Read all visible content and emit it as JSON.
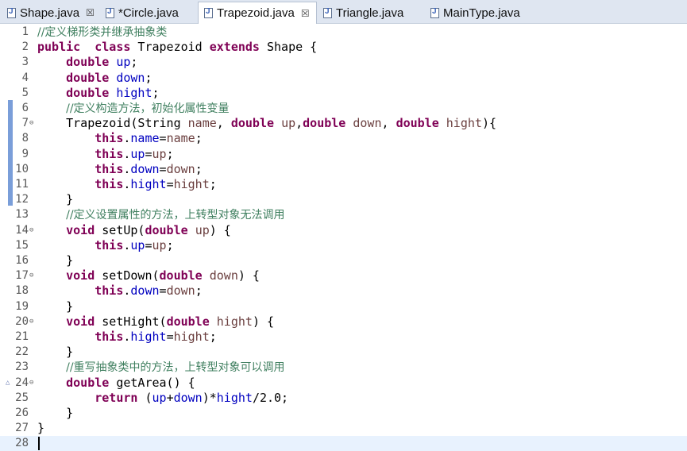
{
  "tabs": [
    {
      "label": "Shape.java",
      "closable": true
    },
    {
      "label": "*Circle.java",
      "closable": false
    },
    {
      "label": "Trapezoid.java",
      "closable": true,
      "active": true
    },
    {
      "label": "Triangle.java",
      "closable": false
    },
    {
      "label": "MainType.java",
      "closable": false
    }
  ],
  "close_glyph": "☒",
  "editor": {
    "lines": [
      {
        "n": "1",
        "t": [
          [
            "cm",
            "//定义梯形类并继承抽象类"
          ]
        ]
      },
      {
        "n": "2",
        "t": [
          [
            "kw",
            "public"
          ],
          [
            "",
            "  "
          ],
          [
            "kw",
            "class"
          ],
          [
            "",
            " Trapezoid "
          ],
          [
            "kw",
            "extends"
          ],
          [
            "",
            " Shape {"
          ]
        ]
      },
      {
        "n": "3",
        "t": [
          [
            "",
            "    "
          ],
          [
            "kw",
            "double"
          ],
          [
            "",
            " "
          ],
          [
            "fld",
            "up"
          ],
          [
            "",
            ";"
          ]
        ]
      },
      {
        "n": "4",
        "t": [
          [
            "",
            "    "
          ],
          [
            "kw",
            "double"
          ],
          [
            "",
            " "
          ],
          [
            "fld",
            "down"
          ],
          [
            "",
            ";"
          ]
        ]
      },
      {
        "n": "5",
        "t": [
          [
            "",
            "    "
          ],
          [
            "kw",
            "double"
          ],
          [
            "",
            " "
          ],
          [
            "fld",
            "hight"
          ],
          [
            "",
            ";"
          ]
        ]
      },
      {
        "n": "6",
        "t": [
          [
            "",
            "    "
          ],
          [
            "cm",
            "//定义构造方法，初始化属性变量"
          ]
        ]
      },
      {
        "n": "7",
        "fold": true,
        "t": [
          [
            "",
            "    Trapezoid(String "
          ],
          [
            "par",
            "name"
          ],
          [
            "",
            ", "
          ],
          [
            "kw",
            "double"
          ],
          [
            "",
            " "
          ],
          [
            "par",
            "up"
          ],
          [
            "",
            ","
          ],
          [
            "kw",
            "double"
          ],
          [
            "",
            " "
          ],
          [
            "par",
            "down"
          ],
          [
            "",
            ", "
          ],
          [
            "kw",
            "double"
          ],
          [
            "",
            " "
          ],
          [
            "par",
            "hight"
          ],
          [
            "",
            "){"
          ]
        ]
      },
      {
        "n": "8",
        "t": [
          [
            "",
            "        "
          ],
          [
            "kw",
            "this"
          ],
          [
            "",
            "."
          ],
          [
            "fld",
            "name"
          ],
          [
            "",
            "="
          ],
          [
            "par",
            "name"
          ],
          [
            "",
            ";"
          ]
        ]
      },
      {
        "n": "9",
        "t": [
          [
            "",
            "        "
          ],
          [
            "kw",
            "this"
          ],
          [
            "",
            "."
          ],
          [
            "fld",
            "up"
          ],
          [
            "",
            "="
          ],
          [
            "par",
            "up"
          ],
          [
            "",
            ";"
          ]
        ]
      },
      {
        "n": "10",
        "t": [
          [
            "",
            "        "
          ],
          [
            "kw",
            "this"
          ],
          [
            "",
            "."
          ],
          [
            "fld",
            "down"
          ],
          [
            "",
            "="
          ],
          [
            "par",
            "down"
          ],
          [
            "",
            ";"
          ]
        ]
      },
      {
        "n": "11",
        "t": [
          [
            "",
            "        "
          ],
          [
            "kw",
            "this"
          ],
          [
            "",
            "."
          ],
          [
            "fld",
            "hight"
          ],
          [
            "",
            "="
          ],
          [
            "par",
            "hight"
          ],
          [
            "",
            ";"
          ]
        ]
      },
      {
        "n": "12",
        "t": [
          [
            "",
            "    }"
          ]
        ]
      },
      {
        "n": "13",
        "t": [
          [
            "",
            "    "
          ],
          [
            "cm",
            "//定义设置属性的方法，上转型对象无法调用"
          ]
        ]
      },
      {
        "n": "14",
        "fold": true,
        "t": [
          [
            "",
            "    "
          ],
          [
            "kw",
            "void"
          ],
          [
            "",
            " setUp("
          ],
          [
            "kw",
            "double"
          ],
          [
            "",
            " "
          ],
          [
            "par",
            "up"
          ],
          [
            "",
            ") {"
          ]
        ]
      },
      {
        "n": "15",
        "t": [
          [
            "",
            "        "
          ],
          [
            "kw",
            "this"
          ],
          [
            "",
            "."
          ],
          [
            "fld",
            "up"
          ],
          [
            "",
            "="
          ],
          [
            "par",
            "up"
          ],
          [
            "",
            ";"
          ]
        ]
      },
      {
        "n": "16",
        "t": [
          [
            "",
            "    }"
          ]
        ]
      },
      {
        "n": "17",
        "fold": true,
        "t": [
          [
            "",
            "    "
          ],
          [
            "kw",
            "void"
          ],
          [
            "",
            " setDown("
          ],
          [
            "kw",
            "double"
          ],
          [
            "",
            " "
          ],
          [
            "par",
            "down"
          ],
          [
            "",
            ") {"
          ]
        ]
      },
      {
        "n": "18",
        "t": [
          [
            "",
            "        "
          ],
          [
            "kw",
            "this"
          ],
          [
            "",
            "."
          ],
          [
            "fld",
            "down"
          ],
          [
            "",
            "="
          ],
          [
            "par",
            "down"
          ],
          [
            "",
            ";"
          ]
        ]
      },
      {
        "n": "19",
        "t": [
          [
            "",
            "    }"
          ]
        ]
      },
      {
        "n": "20",
        "fold": true,
        "t": [
          [
            "",
            "    "
          ],
          [
            "kw",
            "void"
          ],
          [
            "",
            " setHight("
          ],
          [
            "kw",
            "double"
          ],
          [
            "",
            " "
          ],
          [
            "par",
            "hight"
          ],
          [
            "",
            ") {"
          ]
        ]
      },
      {
        "n": "21",
        "t": [
          [
            "",
            "        "
          ],
          [
            "kw",
            "this"
          ],
          [
            "",
            "."
          ],
          [
            "fld",
            "hight"
          ],
          [
            "",
            "="
          ],
          [
            "par",
            "hight"
          ],
          [
            "",
            ";"
          ]
        ]
      },
      {
        "n": "22",
        "t": [
          [
            "",
            "    }"
          ]
        ]
      },
      {
        "n": "23",
        "t": [
          [
            "",
            "    "
          ],
          [
            "cm",
            "//重写抽象类中的方法，上转型对象可以调用"
          ]
        ]
      },
      {
        "n": "24",
        "fold": true,
        "override": true,
        "t": [
          [
            "",
            "    "
          ],
          [
            "kw",
            "double"
          ],
          [
            "",
            " getArea() {"
          ]
        ]
      },
      {
        "n": "25",
        "t": [
          [
            "",
            "        "
          ],
          [
            "kw",
            "return"
          ],
          [
            "",
            " ("
          ],
          [
            "fld",
            "up"
          ],
          [
            "",
            "+"
          ],
          [
            "fld",
            "down"
          ],
          [
            "",
            ")*"
          ],
          [
            "fld",
            "hight"
          ],
          [
            "",
            "/2.0;"
          ]
        ]
      },
      {
        "n": "26",
        "t": [
          [
            "",
            "    }"
          ]
        ]
      },
      {
        "n": "27",
        "t": [
          [
            "",
            "}"
          ]
        ]
      },
      {
        "n": "28",
        "current": true,
        "t": []
      }
    ]
  }
}
